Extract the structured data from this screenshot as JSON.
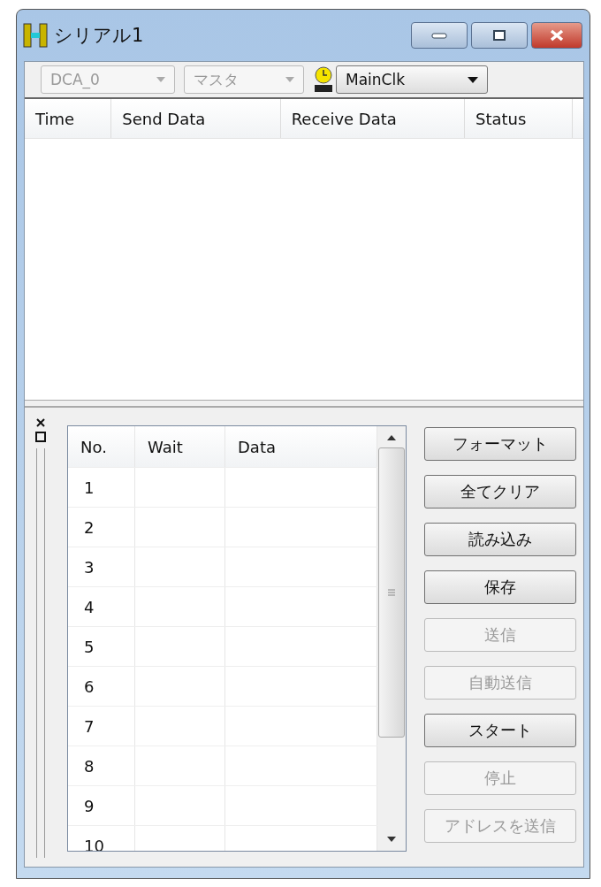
{
  "window": {
    "title": "シリアル1"
  },
  "toolbar": {
    "dropdowns": [
      {
        "value": "DCA_0",
        "disabled": true
      },
      {
        "value": "マスタ",
        "disabled": true
      }
    ],
    "clock_dropdown": {
      "value": "MainClk",
      "disabled": false
    }
  },
  "log_table": {
    "columns": [
      "Time",
      "Send Data",
      "Receive Data",
      "Status"
    ]
  },
  "data_table": {
    "columns": [
      "No.",
      "Wait",
      "Data"
    ],
    "rows": [
      "1",
      "2",
      "3",
      "4",
      "5",
      "6",
      "7",
      "8",
      "9",
      "10"
    ]
  },
  "buttons": [
    {
      "label": "フォーマット",
      "disabled": false
    },
    {
      "label": "全てクリア",
      "disabled": false
    },
    {
      "label": "読み込み",
      "disabled": false
    },
    {
      "label": "保存",
      "disabled": false
    },
    {
      "label": "送信",
      "disabled": true
    },
    {
      "label": "自動送信",
      "disabled": true
    },
    {
      "label": "スタート",
      "disabled": false
    },
    {
      "label": "停止",
      "disabled": true
    },
    {
      "label": "アドレスを送信",
      "disabled": true
    }
  ]
}
